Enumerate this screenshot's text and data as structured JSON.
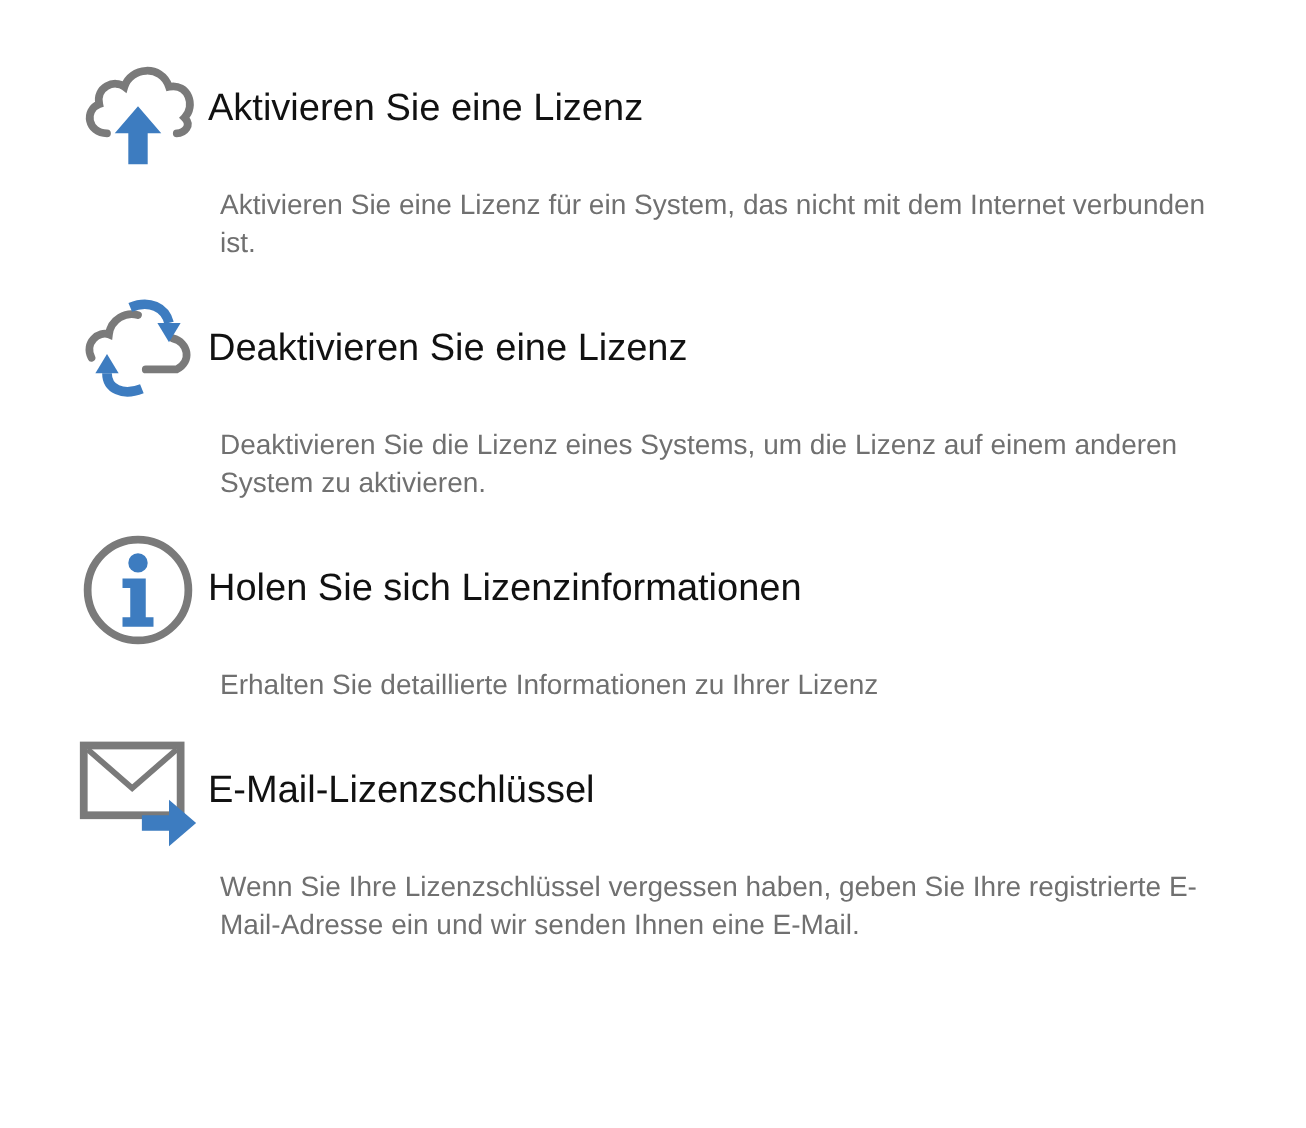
{
  "items": [
    {
      "kind": "cloud-upload",
      "title": "Aktivieren Sie eine Lizenz",
      "description": "Aktivieren Sie eine Lizenz für ein System, das nicht mit dem Internet verbunden ist."
    },
    {
      "kind": "cloud-sync",
      "title": "Deaktivieren Sie eine Lizenz",
      "description": "Deaktivieren Sie die Lizenz eines Systems, um die Lizenz auf einem anderen System zu aktivieren."
    },
    {
      "kind": "info",
      "title": "Holen Sie sich Lizenzinformationen",
      "description": "Erhalten Sie detaillierte Informationen zu Ihrer Lizenz"
    },
    {
      "kind": "mail",
      "title": "E-Mail-Lizenzschlüssel",
      "description": "Wenn Sie Ihre Lizenzschlüssel vergessen haben, geben Sie Ihre registrierte E-Mail-Adresse ein und wir senden Ihnen eine E-Mail."
    }
  ]
}
